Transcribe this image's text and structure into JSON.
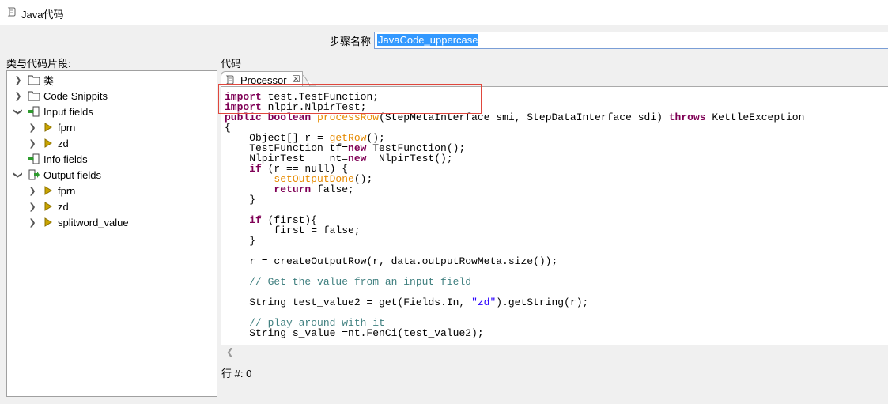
{
  "window": {
    "title": "Java代码",
    "icon": "script-icon"
  },
  "step": {
    "label": "步骤名称",
    "value": "JavaCode_uppercase"
  },
  "left_panel": {
    "label": "类与代码片段:",
    "items": [
      {
        "label": "类",
        "icon": "folder-icon",
        "expanded": false
      },
      {
        "label": "Code Snippits",
        "icon": "folder-icon",
        "expanded": false
      },
      {
        "label": "Input fields",
        "icon": "input-fields-icon",
        "expanded": true
      },
      {
        "label": "fprn",
        "icon": "field-arrow-icon",
        "expanded": false
      },
      {
        "label": "zd",
        "icon": "field-arrow-icon",
        "expanded": false
      },
      {
        "label": "Info fields",
        "icon": "info-fields-icon",
        "expanded": false
      },
      {
        "label": "Output fields",
        "icon": "output-fields-icon",
        "expanded": true
      },
      {
        "label": "fprn",
        "icon": "field-arrow-icon",
        "expanded": false
      },
      {
        "label": "zd",
        "icon": "field-arrow-icon",
        "expanded": false
      },
      {
        "label": "splitword_value",
        "icon": "field-arrow-icon",
        "expanded": false
      }
    ]
  },
  "code_panel": {
    "label": "代码",
    "tab_label": "Processor",
    "lines": [
      "import test.TestFunction;",
      "import nlpir.NlpirTest;",
      "public boolean processRow(StepMetaInterface smi, StepDataInterface sdi) throws KettleException",
      "{",
      "    Object[] r = getRow();",
      "    TestFunction tf=new TestFunction();",
      "    NlpirTest    nt=new  NlpirTest();",
      "    if (r == null) {",
      "        setOutputDone();",
      "        return false;",
      "    }",
      "",
      "    if (first){",
      "        first = false;",
      "    }",
      "",
      "    r = createOutputRow(r, data.outputRowMeta.size());",
      "",
      "    // Get the value from an input field",
      "",
      "    String test_value2 = get(Fields.In, \"zd\").getString(r);",
      "",
      "    // play around with it",
      "    String s_value =nt.FenCi(test_value2);"
    ]
  },
  "status": {
    "row_label": "行 #: 0"
  }
}
